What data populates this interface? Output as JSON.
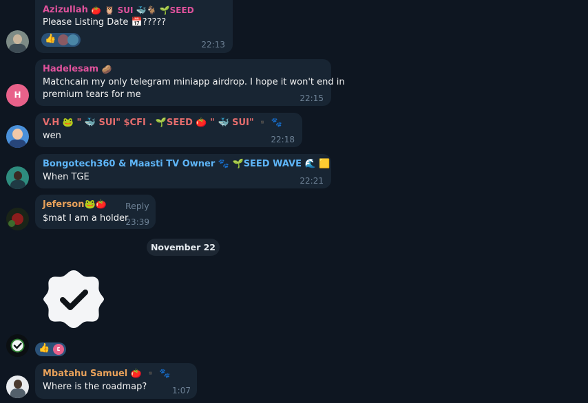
{
  "messages": [
    {
      "name": "Azizullah",
      "name_emojis": "🍅 🦉 SUI 🐳🐐 🌱SEED",
      "text": "Please Listing Date 📅?????",
      "time": "22:13",
      "name_color": "#e0529c"
    },
    {
      "name": "Hadelesam",
      "name_emojis": "🥔",
      "avatar_letter": "H",
      "text_line1": "Matchcain my only telegram miniapp airdrop. I hope it won't end in",
      "text_line2": "premium tears for me",
      "time": "22:15",
      "name_color": "#e0529c"
    },
    {
      "name": "V.H 🐸 \" 🐳 SUI\" $CFI . 🌱SEED 🍅 \" 🐳 SUI\" ▪️ 🐾",
      "text": "wen",
      "time": "22:18",
      "name_color": "#e56d6d"
    },
    {
      "name": "Bongotech360 & Maasti TV Owner 🐾 🌱SEED WAVE 🌊 🟨",
      "text": "When TGE",
      "time": "22:21",
      "name_color": "#5eb5f7"
    },
    {
      "name": "Jeferson🐸🍅",
      "reply_label": "Reply",
      "text": "$mat I am a holder",
      "time": "23:39",
      "name_color": "#e8a15a"
    },
    {
      "name": "Mbatahu Samuel 🍅 ▪️ 🐾",
      "text": "Where is the roadmap?",
      "time": "1:07",
      "name_color": "#e8a15a"
    }
  ],
  "date_separator": "November 22",
  "reactions": {
    "thumbs": "👍",
    "reaction_letter": "E"
  },
  "colors": {
    "background": "#0e1621",
    "bubble": "#182533",
    "accent": "#5eb5f7"
  }
}
